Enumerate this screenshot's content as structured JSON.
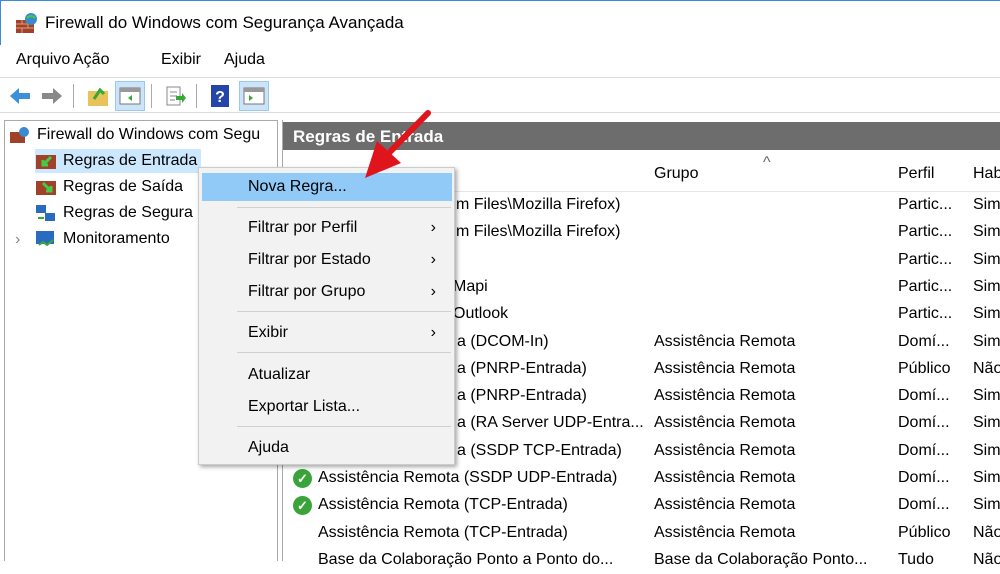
{
  "window": {
    "title": "Firewall do Windows com Segurança Avançada"
  },
  "menubar": [
    "Arquivo",
    "Ação",
    "Exibir",
    "Ajuda"
  ],
  "toolbar": [
    "back-icon",
    "forward-icon",
    "up-folder-icon",
    "show-hide-tree-icon",
    "export-icon",
    "help-icon",
    "show-hide-action-pane-icon"
  ],
  "tree": {
    "root": "Firewall do Windows com Segu",
    "items": [
      "Regras de Entrada",
      "Regras de Saída",
      "Regras de Segura",
      "Monitoramento"
    ]
  },
  "panel": {
    "title": "Regras de Entrada",
    "columns": [
      "Grupo",
      "Perfil",
      "Hab"
    ]
  },
  "rows": [
    {
      "name": "m Files\\Mozilla Firefox)",
      "group": "",
      "profile": "Partic...",
      "enabled": "Sim",
      "partial": true
    },
    {
      "name": "m Files\\Mozilla Firefox)",
      "group": "",
      "profile": "Partic...",
      "enabled": "Sim",
      "partial": true
    },
    {
      "name": "",
      "group": "",
      "profile": "Partic...",
      "enabled": "Sim",
      "partial": true
    },
    {
      "name": "Mapi",
      "group": "",
      "profile": "Partic...",
      "enabled": "Sim",
      "partial": true
    },
    {
      "name": "Outlook",
      "group": "",
      "profile": "Partic...",
      "enabled": "Sim",
      "partial": true
    },
    {
      "name": "a (DCOM-In)",
      "group": "Assistência Remota",
      "profile": "Domí...",
      "enabled": "Sim",
      "partial": true
    },
    {
      "name": "a (PNRP-Entrada)",
      "group": "Assistência Remota",
      "profile": "Público",
      "enabled": "Não",
      "partial": true
    },
    {
      "name": "a (PNRP-Entrada)",
      "group": "Assistência Remota",
      "profile": "Domí...",
      "enabled": "Sim",
      "partial": true
    },
    {
      "name": "a (RA Server UDP-Entra...",
      "group": "Assistência Remota",
      "profile": "Domí...",
      "enabled": "Sim",
      "partial": true
    },
    {
      "name": "a (SSDP TCP-Entrada)",
      "group": "Assistência Remota",
      "profile": "Domí...",
      "enabled": "Sim",
      "partial": true
    },
    {
      "name": "Assistência Remota (SSDP UDP-Entrada)",
      "group": "Assistência Remota",
      "profile": "Domí...",
      "enabled": "Sim",
      "check": true
    },
    {
      "name": "Assistência Remota (TCP-Entrada)",
      "group": "Assistência Remota",
      "profile": "Domí...",
      "enabled": "Sim",
      "check": true
    },
    {
      "name": "Assistência Remota (TCP-Entrada)",
      "group": "Assistência Remota",
      "profile": "Público",
      "enabled": "Não"
    },
    {
      "name": "Base da Colaboração Ponto a Ponto do...",
      "group": "Base da Colaboração Ponto...",
      "profile": "Tudo",
      "enabled": "Não"
    }
  ],
  "context_menu": {
    "items": [
      "Nova Regra...",
      "Filtrar por Perfil",
      "Filtrar por Estado",
      "Filtrar por Grupo",
      "Exibir",
      "Atualizar",
      "Exportar Lista...",
      "Ajuda"
    ]
  },
  "colors": {
    "highlight": "#91c9f7",
    "header": "#6d6d6d",
    "arrow": "#e0141b"
  }
}
